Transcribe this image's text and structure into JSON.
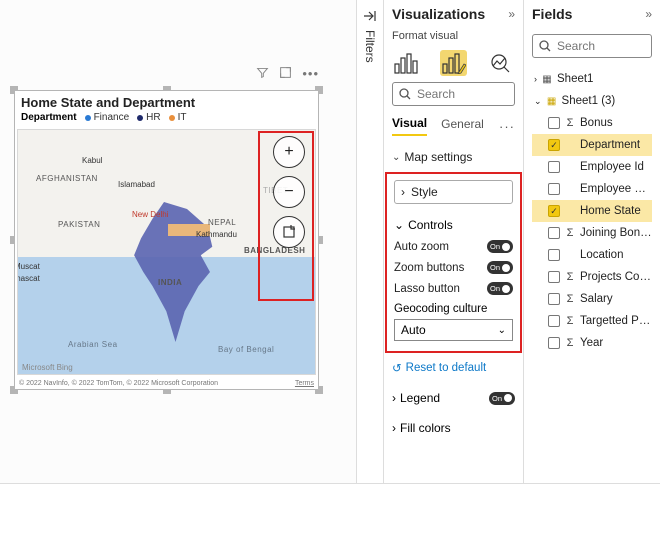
{
  "filters_rail": {
    "label": "Filters"
  },
  "viz": {
    "title": "Visualizations",
    "subtitle": "Format visual",
    "search_placeholder": "Search",
    "tabs": {
      "visual": "Visual",
      "general": "General"
    },
    "map_settings": "Map settings",
    "style": "Style",
    "controls_header": "Controls",
    "controls": {
      "auto_zoom": "Auto zoom",
      "zoom_buttons": "Zoom buttons",
      "lasso_button": "Lasso button",
      "on": "On"
    },
    "geo_label": "Geocoding culture",
    "geo_value": "Auto",
    "reset": "Reset to default",
    "legend": "Legend",
    "fill_colors": "Fill colors"
  },
  "fields": {
    "title": "Fields",
    "search_placeholder": "Search",
    "table1": "Sheet1",
    "table2": "Sheet1 (3)",
    "items": [
      {
        "label": "Bonus",
        "checked": false,
        "agg": true
      },
      {
        "label": "Department",
        "checked": true,
        "agg": false
      },
      {
        "label": "Employee Id",
        "checked": false,
        "agg": false
      },
      {
        "label": "Employee Name",
        "checked": false,
        "agg": false
      },
      {
        "label": "Home State",
        "checked": true,
        "agg": false
      },
      {
        "label": "Joining Bonus",
        "checked": false,
        "agg": true
      },
      {
        "label": "Location",
        "checked": false,
        "agg": false
      },
      {
        "label": "Projects Complet...",
        "checked": false,
        "agg": true
      },
      {
        "label": "Salary",
        "checked": false,
        "agg": true
      },
      {
        "label": "Targetted Projects",
        "checked": false,
        "agg": true
      },
      {
        "label": "Year",
        "checked": false,
        "agg": true
      }
    ]
  },
  "visual": {
    "title": "Home State and Department",
    "legend_label": "Department",
    "legend_items": [
      {
        "label": "Finance",
        "color": "#2a7ad4"
      },
      {
        "label": "HR",
        "color": "#1f2a6b"
      },
      {
        "label": "IT",
        "color": "#e98f3c"
      }
    ],
    "map_labels": {
      "afg": "AFGHANISTAN",
      "pak": "PAKISTAN",
      "india": "INDIA",
      "nepal": "NEPAL",
      "bang": "BANGLADESH",
      "tibet": "TIBET",
      "kabul": "Kabul",
      "isb": "Islamabad",
      "delhi": "New Delhi",
      "ktm": "Kathmandu",
      "muscat": "Muscat",
      "mascat": "mascat",
      "arab": "Arabian Sea",
      "bay": "Bay of Bengal"
    },
    "bing": "Microsoft Bing",
    "credits": "© 2022 NavInfo, © 2022 TomTom, © 2022 Microsoft Corporation",
    "terms": "Terms"
  }
}
